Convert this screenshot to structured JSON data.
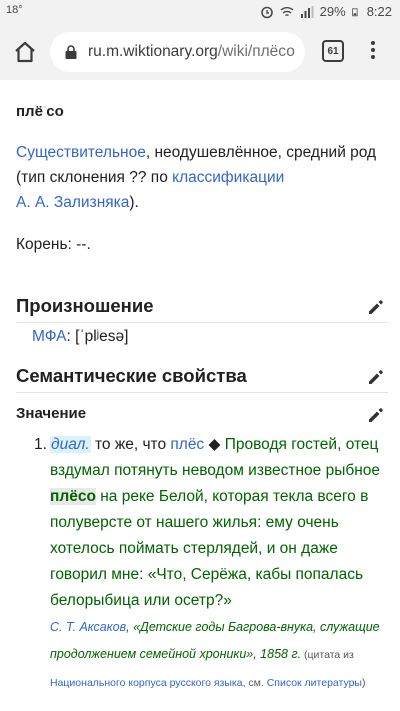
{
  "status_bar": {
    "temperature": "18°",
    "battery": "29%",
    "time": "8:22"
  },
  "browser": {
    "url_host": "ru.m.wiktionary.org",
    "url_path": "/wiki/плёсо",
    "tab_count": "61"
  },
  "article": {
    "headword_pre": "плё",
    "headword_stress_mark": "-",
    "headword_post": "со",
    "morph_link_noun": "Существительное",
    "morph_text": ", неодушевлённое, средний род (тип склонения ?? по ",
    "morph_link_class": "классификации",
    "morph_link_author": "А. А. Зализняка",
    "morph_end": ").",
    "root_label": "Корень: ",
    "root_value": "--.",
    "pronunciation_heading": "Произношение",
    "ipa_label": "МФА",
    "ipa_value": ": [ˈplʲesə]",
    "semantic_heading": "Семантические свойства",
    "meaning_heading": "Значение",
    "definition": {
      "number": "1.",
      "dialect_label": "диал.",
      "same_as": " то же, что ",
      "same_as_link": "плёс",
      "diamond": " ◆ ",
      "quote_before": "Проводя гостей, отец вздумал потянуть неводом известное рыбное ",
      "quote_word": "плёсо",
      "quote_after": " на реке Белой, которая текла всего в полуверсте от нашего жилья: ему очень хотелось поймать стерлядей, и он даже говорил мне: «Что, Серёжа, кабы попалась белорыбица или осетр?»",
      "author_link": "С. Т. Аксаков",
      "work": ", «Детские годы Багрова-внука, служащие продолжением семейной хроники», 1858 г.",
      "note_1": " (цитата из ",
      "note_link_corpus": "Национального корпуса русского языка",
      "note_2": ", см. ",
      "note_link_lit": "Список литературы",
      "note_3": ")"
    }
  }
}
